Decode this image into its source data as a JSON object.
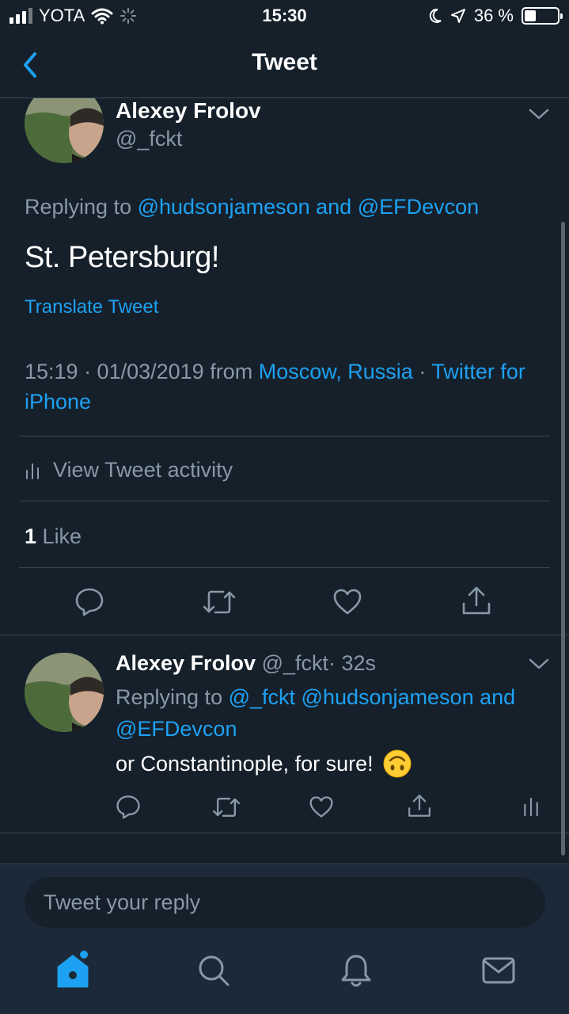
{
  "status_bar": {
    "carrier": "YOTA",
    "time": "15:30",
    "battery": "36 %",
    "battery_level": 0.36
  },
  "nav": {
    "title": "Tweet"
  },
  "main_tweet": {
    "author_name": "Alexey Frolov",
    "author_handle": "@_fckt",
    "replying_prefix": "Replying to",
    "replying_to": "@hudsonjameson and @EFDevcon",
    "text": "St. Petersburg!",
    "translate_label": "Translate Tweet",
    "timestamp": "15:19 · 01/03/2019 from",
    "location": "Moscow, Russia",
    "separator": "·",
    "client": "Twitter for iPhone",
    "activity_label": "View Tweet activity",
    "likes_count": "1",
    "likes_label": "Like"
  },
  "reply_tweet": {
    "author_name": "Alexey Frolov",
    "author_handle": "@_fckt",
    "time": "· 32s",
    "replying_prefix": "Replying to",
    "replying_to": "@_fckt @hudsonjameson and @EFDevcon",
    "text": "or Constantinople, for sure!",
    "emoji": "upside-down-face-emoji"
  },
  "compose": {
    "placeholder": "Tweet your reply"
  },
  "tabs": [
    {
      "icon": "home-icon",
      "active": true
    },
    {
      "icon": "search-icon",
      "active": false
    },
    {
      "icon": "bell-icon",
      "active": false
    },
    {
      "icon": "mail-icon",
      "active": false
    }
  ],
  "colors": {
    "background": "#15202b",
    "accent": "#1da1f2",
    "secondary_text": "#8899a6",
    "divider": "#38444d"
  }
}
